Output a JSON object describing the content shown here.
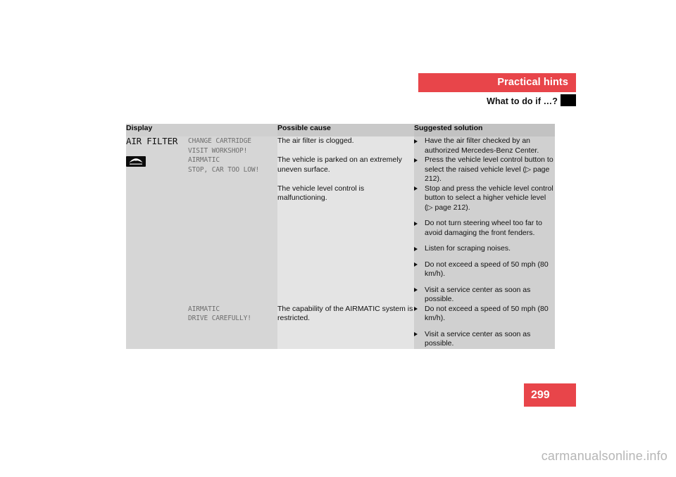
{
  "header": {
    "chapter": "Practical hints",
    "section": "What to do if …?",
    "marker_icon": "black-square-marker"
  },
  "table": {
    "columns": [
      "Display",
      "Possible cause",
      "Suggested solution"
    ],
    "rows": [
      {
        "display_code": "AIR FILTER",
        "display_icon": null,
        "display_message": "CHANGE CARTRIDGE\nVISIT WORKSHOP!",
        "causes": [
          {
            "text": "The air filter is clogged.",
            "solutions": [
              "Have the air filter checked by an authorized Mercedes-Benz Center."
            ]
          }
        ]
      },
      {
        "display_code": "",
        "display_icon": "vehicle-too-low-warning-icon",
        "display_message": "AIRMATIC\nSTOP, CAR TOO LOW!",
        "causes": [
          {
            "text": "The vehicle is parked on an extremely uneven surface.",
            "solutions": [
              "Press the vehicle level control button to select the raised vehicle level (▷ page 212)."
            ]
          },
          {
            "text": "The vehicle level control is malfunctioning.",
            "solutions": [
              "Stop and press the vehicle level control button to select a higher vehicle level (▷ page 212).",
              "Do not turn steering wheel too far to avoid damaging the front fenders.",
              "Listen for scraping noises.",
              "Do not exceed a speed of 50 mph (80 km/h).",
              "Visit a service center as soon as possible."
            ]
          }
        ]
      },
      {
        "display_code": "",
        "display_icon": null,
        "display_message": "AIRMATIC\nDRIVE CAREFULLY!",
        "causes": [
          {
            "text": "The capability of the AIRMATIC system is restricted.",
            "solutions": [
              "Do not exceed a speed of 50 mph (80 km/h).",
              "Visit a service center as soon as possible."
            ]
          }
        ]
      }
    ]
  },
  "footer": {
    "page_number": "299",
    "watermark": "carmanualsonline.info"
  },
  "colors": {
    "accent_red": "#e8454a",
    "header_band": "#cfcfcf",
    "col_display": "#d6d6d6",
    "col_cause": "#e4e4e4",
    "col_solution": "#d0d0d0"
  }
}
